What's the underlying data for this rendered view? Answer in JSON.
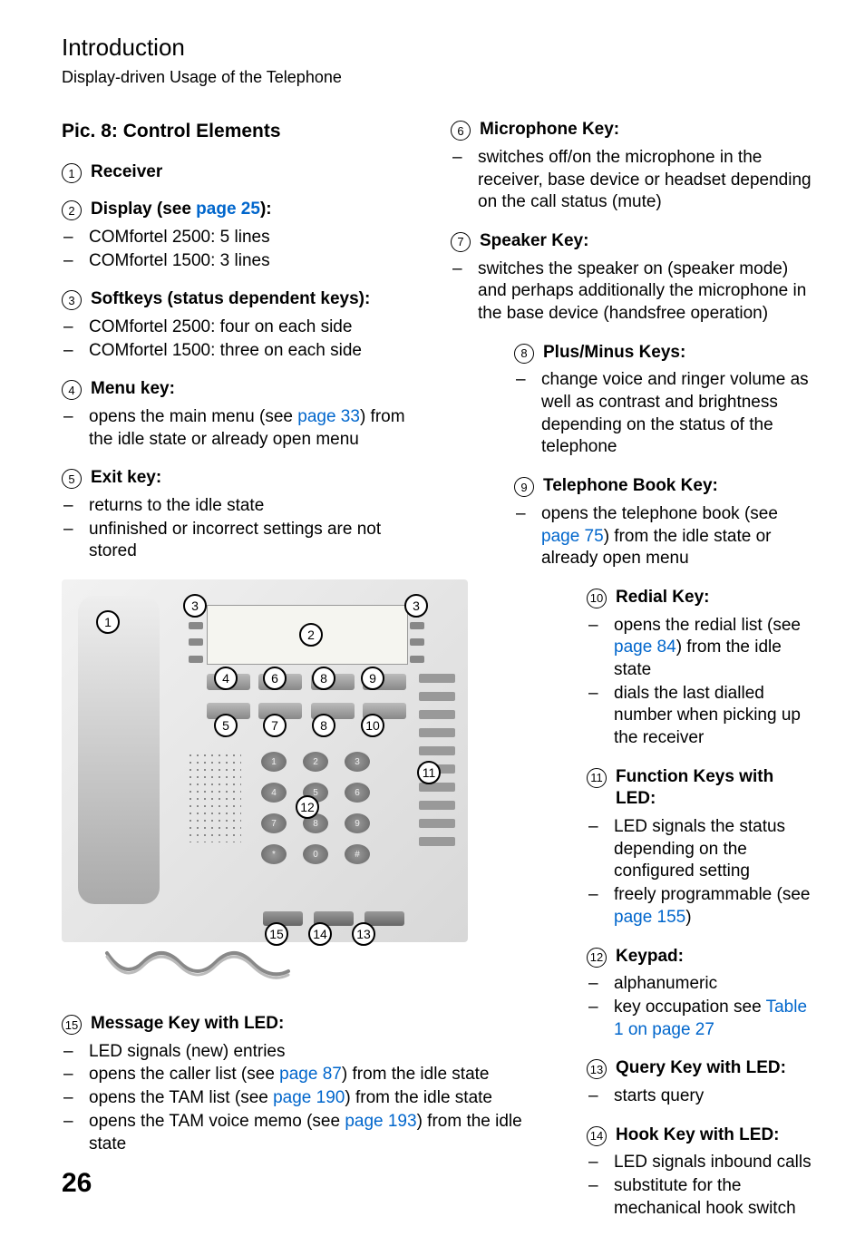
{
  "header": {
    "title": "Introduction",
    "sub": "Display-driven Usage of the Telephone"
  },
  "pic_title": "Pic. 8: Control Elements",
  "page_number": "26",
  "links": {
    "p25": "page 25",
    "p33": "page 33",
    "p75": "page 75",
    "p84": "page 84",
    "p87": "page 87",
    "p155": "page 155",
    "p190": "page 190",
    "p193": "page 193",
    "table1": "Table 1 on page 27"
  },
  "items": {
    "n1": {
      "num": "1",
      "title": "Receiver"
    },
    "n2": {
      "num": "2",
      "title_pre": "Display (see ",
      "title_post": "):",
      "bullets": [
        "COMfortel 2500: 5 lines",
        "COMfortel 1500: 3 lines"
      ]
    },
    "n3": {
      "num": "3",
      "title": "Softkeys (status dependent keys):",
      "bullets": [
        "COMfortel 2500: four on each side",
        "COMfortel 1500: three on each side"
      ]
    },
    "n4": {
      "num": "4",
      "title": "Menu key:",
      "b1_pre": "opens the main menu (see ",
      "b1_post": ") from the idle state or already open menu"
    },
    "n5": {
      "num": "5",
      "title": "Exit key:",
      "bullets": [
        "returns to the idle state",
        "unfinished or incorrect settings are not stored"
      ]
    },
    "n6": {
      "num": "6",
      "title": "Microphone Key:",
      "bullets": [
        "switches off/on the microphone in the receiver, base device or headset depending on the call status (mute)"
      ]
    },
    "n7": {
      "num": "7",
      "title": "Speaker Key:",
      "bullets": [
        "switches the speaker on (speaker mode) and perhaps additionally the microphone in the base device (handsfree operation)"
      ]
    },
    "n8": {
      "num": "8",
      "title": "Plus/Minus Keys:",
      "bullets": [
        "change voice and ringer volume as well as contrast and brightness depending on the status of the telephone"
      ]
    },
    "n9": {
      "num": "9",
      "title": "Telephone Book Key:",
      "b1_pre": "opens the telephone book (see ",
      "b1_post": ") from the idle state or already open menu"
    },
    "n10": {
      "num": "10",
      "title": "Redial Key:",
      "b1_pre": "opens the redial list (see ",
      "b1_post": ") from the idle state",
      "b2": "dials the last dialled number when picking up the receiver"
    },
    "n11": {
      "num": "11",
      "title": "Function Keys with LED:",
      "b1": "LED signals the status depend­ing on the configured setting",
      "b2_pre": "freely programmable (see ",
      "b2_post": ")"
    },
    "n12": {
      "num": "12",
      "title": "Keypad:",
      "b1": "alphanumeric",
      "b2_pre": "key occupation see "
    },
    "n13": {
      "num": "13",
      "title": "Query Key with LED:",
      "bullets": [
        "starts query"
      ]
    },
    "n14": {
      "num": "14",
      "title": "Hook Key with LED:",
      "bullets": [
        "LED signals inbound calls",
        "substitute for the mechanical hook switch"
      ]
    },
    "n15": {
      "num": "15",
      "title": "Message Key with LED:",
      "b1": "LED signals (new) entries",
      "b2_pre": "opens the caller list (see ",
      "b2_post": ") from the idle state",
      "b3_pre": "opens the TAM list (see ",
      "b3_post": ") from the idle state",
      "b4_pre": "opens the TAM voice memo (see ",
      "b4_post": ") from the idle state"
    }
  },
  "callouts": {
    "c1": "1",
    "c2": "2",
    "c3": "3",
    "c4": "4",
    "c5": "5",
    "c6": "6",
    "c7": "7",
    "c8": "8",
    "c9": "9",
    "c10": "10",
    "c11": "11",
    "c12": "12",
    "c13": "13",
    "c14": "14",
    "c15": "15"
  }
}
